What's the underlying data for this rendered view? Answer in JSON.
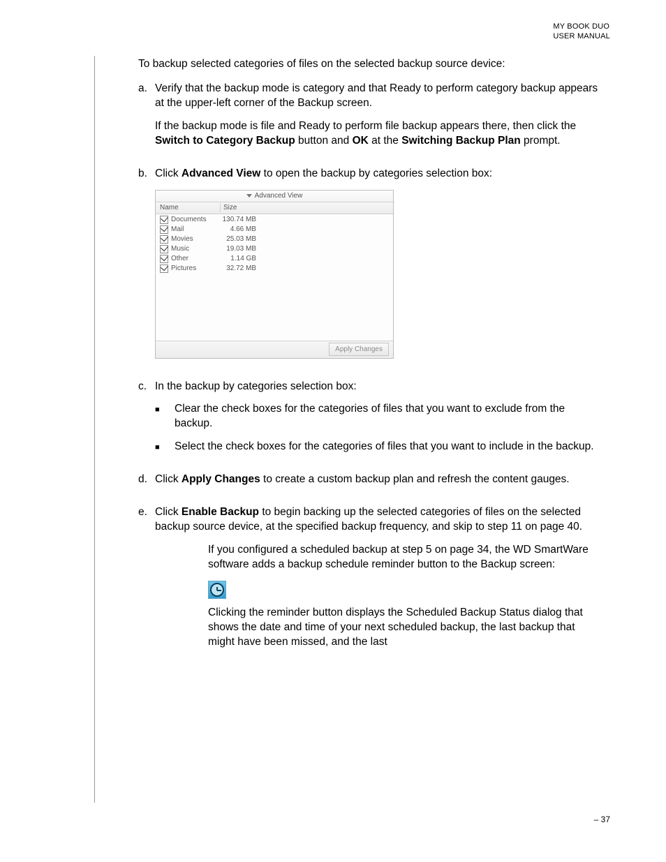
{
  "header": {
    "line1": "MY BOOK DUO",
    "line2": "USER MANUAL"
  },
  "intro": "To backup selected categories of files on the selected backup source device:",
  "steps": {
    "a": {
      "label": "a.",
      "p1": "Verify that the backup mode is category and that Ready to perform category backup appears at the upper-left corner of the Backup screen.",
      "p2_pre": "If the backup mode is file and Ready to perform file backup appears there, then click the ",
      "p2_b1": "Switch to Category Backup",
      "p2_mid1": " button and ",
      "p2_b2": "OK",
      "p2_mid2": " at the ",
      "p2_b3": "Switching Backup Plan",
      "p2_post": " prompt."
    },
    "b": {
      "label": "b.",
      "pre": "Click ",
      "bold": "Advanced View",
      "post": " to open the backup by categories selection box:"
    },
    "c": {
      "label": "c.",
      "lead": "In the backup by categories selection box:",
      "bullet1": "Clear the check boxes for the categories of files that you want to exclude from the backup.",
      "bullet2": "Select the check boxes for the categories of files that you want to include in the backup."
    },
    "d": {
      "label": "d.",
      "pre": "Click ",
      "bold": "Apply Changes",
      "post": " to create a custom backup plan and refresh the content gauges."
    },
    "e": {
      "label": "e.",
      "pre": "Click ",
      "bold": "Enable Backup",
      "post": " to begin backing up the selected categories of files on the selected backup source device, at the specified backup frequency, and skip to step 11 on page 40."
    }
  },
  "panel": {
    "title": "Advanced View",
    "col_name": "Name",
    "col_size": "Size",
    "rows": [
      {
        "name": "Documents",
        "size": "130.74 MB"
      },
      {
        "name": "Mail",
        "size": "4.66 MB"
      },
      {
        "name": "Movies",
        "size": "25.03 MB"
      },
      {
        "name": "Music",
        "size": "19.03 MB"
      },
      {
        "name": "Other",
        "size": "1.14 GB"
      },
      {
        "name": "Pictures",
        "size": "32.72 MB"
      }
    ],
    "apply": "Apply Changes"
  },
  "note": {
    "p1": "If you configured a scheduled backup at step 5 on page 34, the WD SmartWare software adds a backup schedule reminder button to the Backup screen:",
    "p2": "Clicking the reminder button displays the Scheduled Backup Status dialog that shows the date and time of your next scheduled backup, the last backup that might have been missed, and the last"
  },
  "footer": "– 37"
}
